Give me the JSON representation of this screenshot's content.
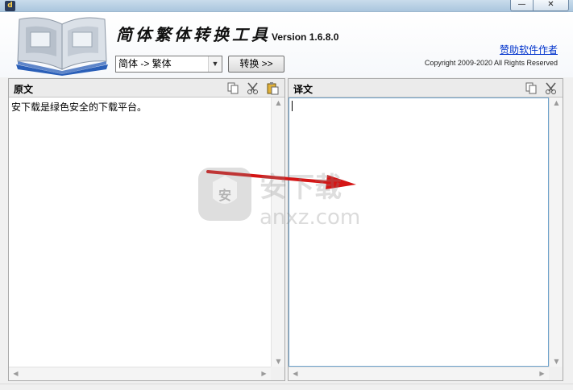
{
  "window": {
    "icon_label": "d",
    "min_glyph": "—",
    "close_glyph": "✕"
  },
  "header": {
    "app_title": "简体繁体转换工具",
    "version": "Version 1.6.8.0",
    "sponsor_link": "赞助软件作者",
    "copyright": "Copyright 2009-2020 All Rights Reserved"
  },
  "controls": {
    "direction_selected": "简体 -> 繁体",
    "convert_label": "转换 >>"
  },
  "source_panel": {
    "title": "原文",
    "text": "安下载是绿色安全的下载平台。",
    "tools": [
      "copy-icon",
      "cut-icon",
      "paste-icon"
    ]
  },
  "target_panel": {
    "title": "译文",
    "text": "",
    "tools": [
      "copy-icon",
      "cut-icon"
    ]
  },
  "watermark": {
    "badge_char": "安",
    "brand": "安下载",
    "domain": "anxz.com"
  },
  "colors": {
    "link": "#0033cc",
    "arrow": "#d41515",
    "focus_border": "#6fa3cc"
  }
}
